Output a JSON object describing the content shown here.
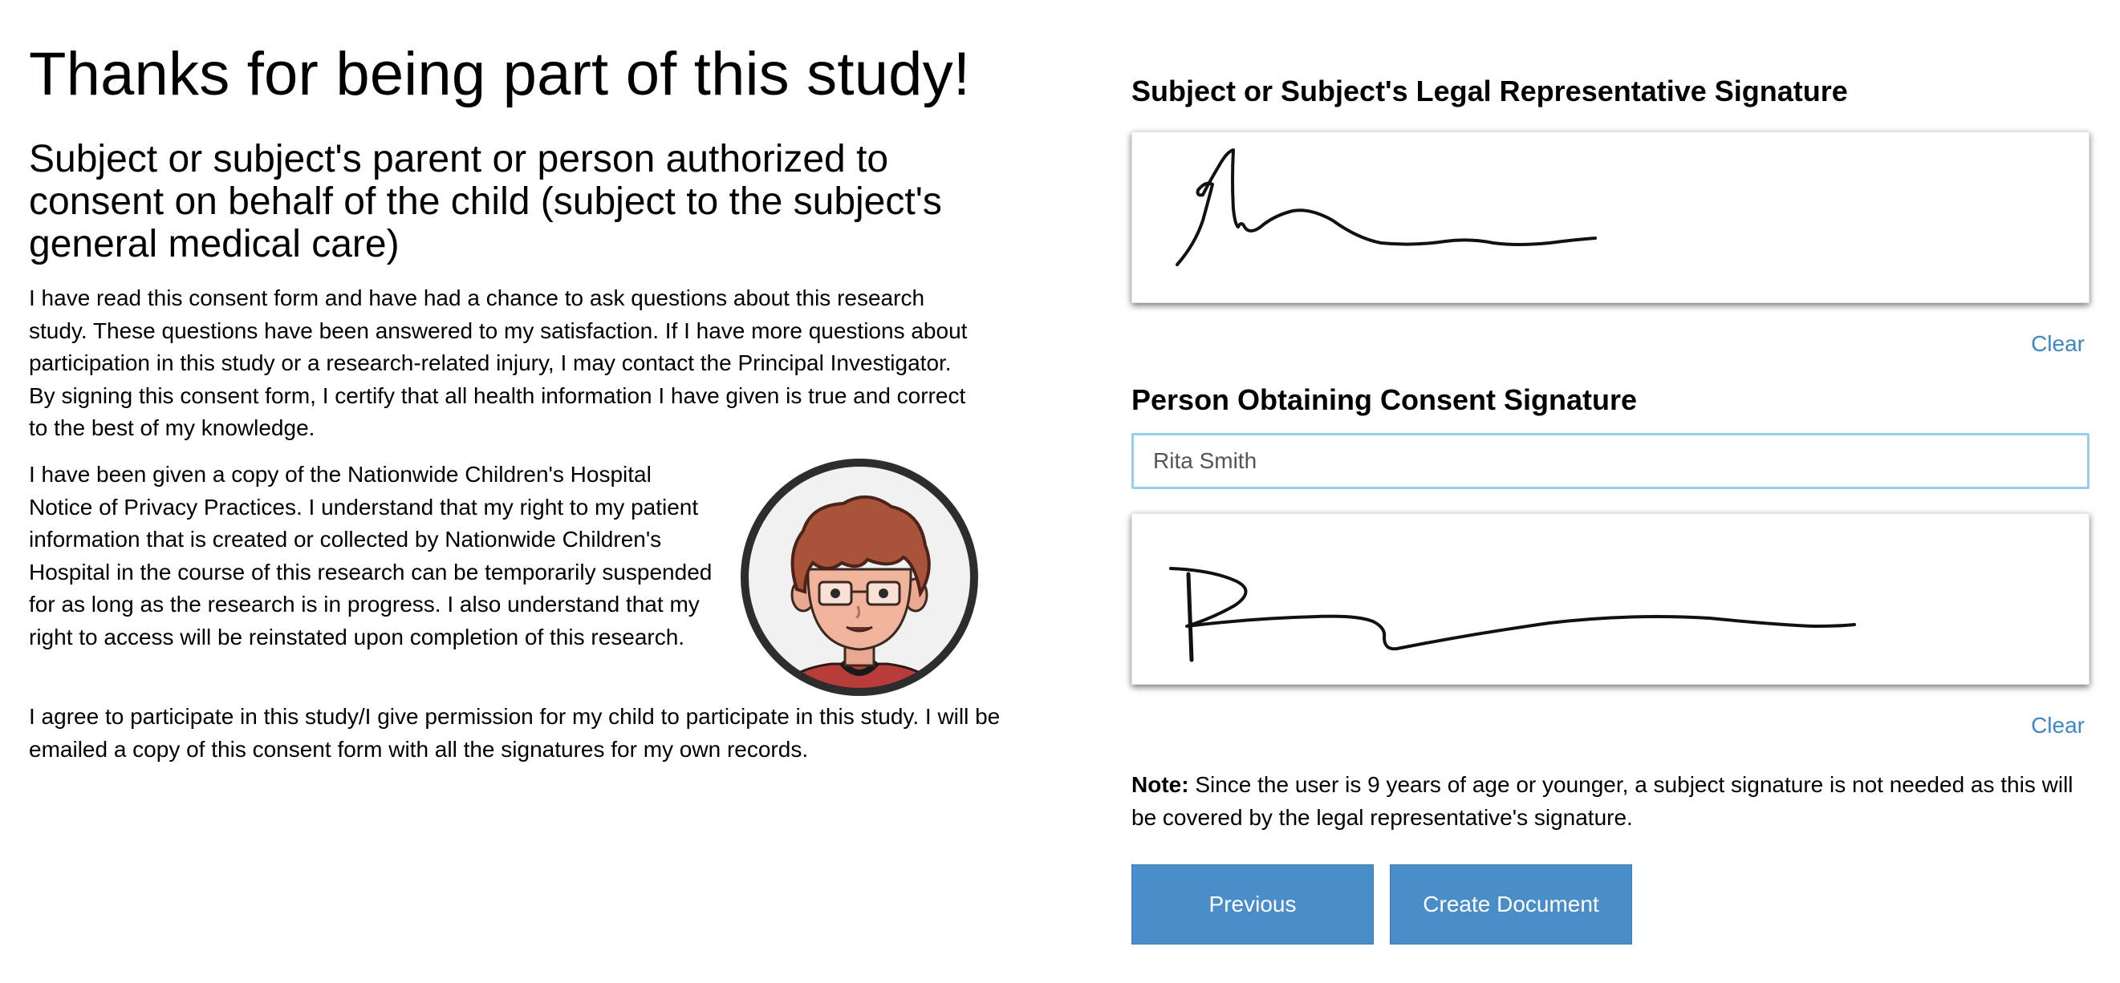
{
  "left": {
    "title": "Thanks for being part of this study!",
    "subheading": "Subject or subject's parent or person authorized to consent on behalf of the child (subject to the subject's general medical care)",
    "paragraph1": "I have read this consent form and have had a chance to ask questions about this research study. These questions have been answered to my satisfaction. If I have more questions about participation in this study or a research-related injury, I may contact the Principal Investigator. By signing this consent form, I certify that all health information I have given is true and correct to the best of my knowledge.",
    "paragraph2": "I have been given a copy of the Nationwide Children's Hospital Notice of Privacy Practices. I understand that my right to my patient information that is created or collected by Nationwide Children's Hospital in the course of this research can be temporarily suspended for as long as the research is in progress. I also understand that my right to access will be reinstated upon completion of this research.",
    "paragraph3": "I agree to participate in this study/I give permission for my child to participate in this study. I will be emailed a copy of this consent form with all the signatures for my own records.",
    "avatar_icon": "cartoon-child-avatar"
  },
  "right": {
    "representative_heading": "Subject or Subject's Legal Representative Signature",
    "representative_clear": "Clear",
    "consent_heading": "Person Obtaining Consent Signature",
    "consent_name_value": "Rita Smith",
    "consent_clear": "Clear",
    "note_label": "Note:",
    "note_text": " Since the user is 9 years of age or younger, a subject signature is not needed as this will be covered by the legal representative's signature.",
    "previous_label": "Previous",
    "create_label": "Create Document"
  },
  "colors": {
    "button_bg": "#4a8ec9",
    "link": "#3d87c6",
    "input_focus_border": "#98cdf0"
  }
}
